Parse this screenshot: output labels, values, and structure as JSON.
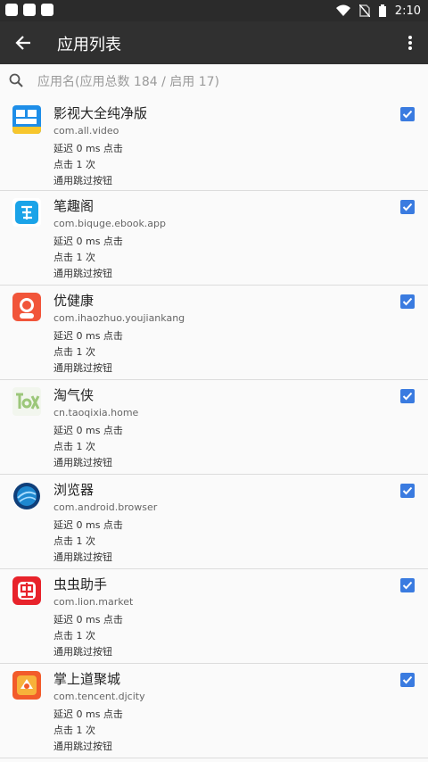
{
  "status": {
    "time": "2:10"
  },
  "toolbar": {
    "title": "应用列表"
  },
  "search": {
    "placeholder": "应用名(应用总数 184 / 启用 17)"
  },
  "colors": {
    "accent": "#3a7be0",
    "toolbar": "#303030"
  },
  "apps": [
    {
      "name": "影视大全纯净版",
      "package": "com.all.video",
      "delay": "延迟 0 ms 点击",
      "clicks": "点击 1 次",
      "rule": "通用跳过按钮",
      "checked": true,
      "icon": "video-app-icon"
    },
    {
      "name": "笔趣阁",
      "package": "com.biquge.ebook.app",
      "delay": "延迟 0 ms 点击",
      "clicks": "点击 1 次",
      "rule": "通用跳过按钮",
      "checked": true,
      "icon": "book-app-icon"
    },
    {
      "name": "优健康",
      "package": "com.ihaozhuo.youjiankang",
      "delay": "延迟 0 ms 点击",
      "clicks": "点击 1 次",
      "rule": "通用跳过按钮",
      "checked": true,
      "icon": "health-app-icon"
    },
    {
      "name": "淘气侠",
      "package": "cn.taoqixia.home",
      "delay": "延迟 0 ms 点击",
      "clicks": "点击 1 次",
      "rule": "通用跳过按钮",
      "checked": true,
      "icon": "taoqixia-app-icon"
    },
    {
      "name": "浏览器",
      "package": "com.android.browser",
      "delay": "延迟 0 ms 点击",
      "clicks": "点击 1 次",
      "rule": "通用跳过按钮",
      "checked": true,
      "icon": "browser-app-icon"
    },
    {
      "name": "虫虫助手",
      "package": "com.lion.market",
      "delay": "延迟 0 ms 点击",
      "clicks": "点击 1 次",
      "rule": "通用跳过按钮",
      "checked": true,
      "icon": "chongchong-app-icon"
    },
    {
      "name": "掌上道聚城",
      "package": "com.tencent.djcity",
      "delay": "延迟 0 ms 点击",
      "clicks": "点击 1 次",
      "rule": "通用跳过按钮",
      "checked": true,
      "icon": "djcity-app-icon"
    }
  ]
}
